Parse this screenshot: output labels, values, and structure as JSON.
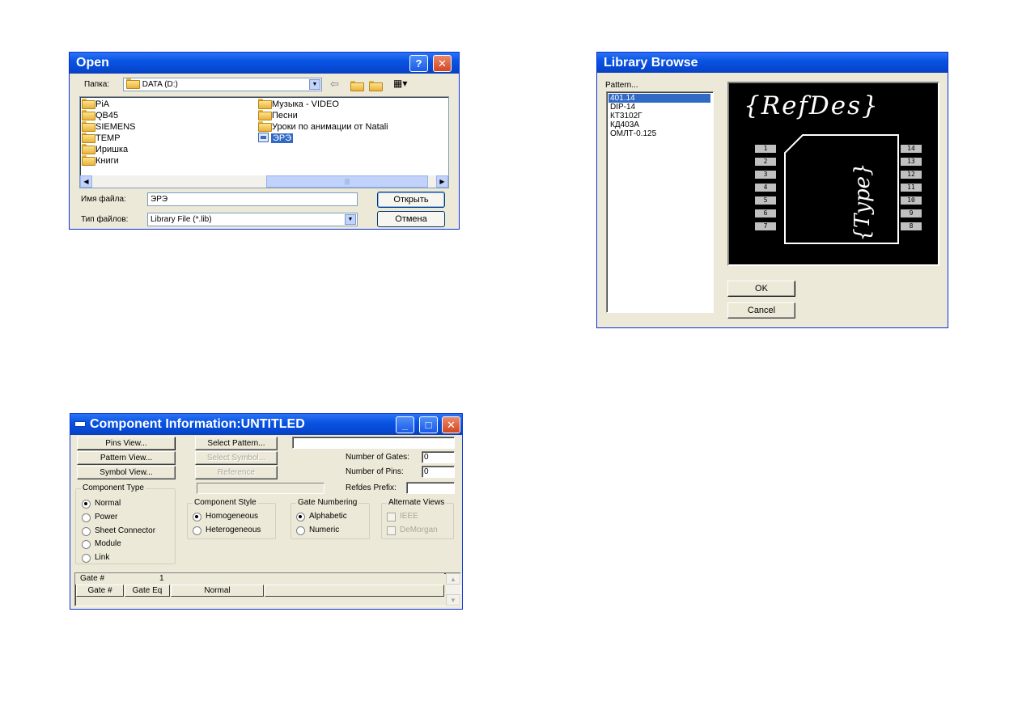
{
  "open_dialog": {
    "title": "Open",
    "help_label": "?",
    "close_label": "✕",
    "look_in_label": "Папка:",
    "look_in_value": "DATA (D:)",
    "items_left": [
      "PiA",
      "QB45",
      "SIEMENS",
      "TEMP",
      "Иришка",
      "Книги"
    ],
    "items_right": [
      "Музыка - VIDEO",
      "Песни",
      "Уроки по анимации от Natali",
      "ЭРЭ"
    ],
    "selected_item": "ЭРЭ",
    "scroll_grip": "|||",
    "filename_label": "Имя файла:",
    "filename_value": "ЭРЭ",
    "filetype_label": "Тип файлов:",
    "filetype_value": "Library File (*.lib)",
    "open_button": "Открыть",
    "cancel_button": "Отмена"
  },
  "library_browse": {
    "title": "Library Browse",
    "pattern_label": "Pattern...",
    "patterns": [
      "401.14",
      "DIP-14",
      "КТ3102Г",
      "КД403А",
      "ОМЛТ-0.125"
    ],
    "selected_pattern": "401.14",
    "preview_refdes": "{RefDes}",
    "preview_type": "{Type}",
    "pins_left": [
      "1",
      "2",
      "3",
      "4",
      "5",
      "6",
      "7"
    ],
    "pins_right": [
      "14",
      "13",
      "12",
      "11",
      "10",
      "9",
      "8"
    ],
    "ok_button": "OK",
    "cancel_button": "Cancel"
  },
  "component_info": {
    "title": "Component Information:UNTITLED",
    "pins_view": "Pins View...",
    "pattern_view": "Pattern View...",
    "symbol_view": "Symbol View...",
    "select_pattern": "Select Pattern...",
    "select_symbol": "Select Symbol...",
    "reference": "Reference",
    "number_of_gates_label": "Number of Gates:",
    "number_of_gates_value": "0",
    "number_of_pins_label": "Number of Pins:",
    "number_of_pins_value": "0",
    "refdes_prefix_label": "Refdes Prefix:",
    "component_type": {
      "title": "Component Type",
      "options": [
        "Normal",
        "Power",
        "Sheet Connector",
        "Module",
        "Link"
      ],
      "selected": "Normal"
    },
    "component_style": {
      "title": "Component Style",
      "options": [
        "Homogeneous",
        "Heterogeneous"
      ],
      "selected": "Homogeneous"
    },
    "gate_numbering": {
      "title": "Gate Numbering",
      "options": [
        "Alphabetic",
        "Numeric"
      ],
      "selected": "Alphabetic"
    },
    "alternate_views": {
      "title": "Alternate Views",
      "options": [
        "IEEE",
        "DeMorgan"
      ]
    },
    "gate_header_label": "Gate #",
    "gate_header_value": "1",
    "columns": [
      "Gate #",
      "Gate Eq",
      "Normal"
    ]
  }
}
